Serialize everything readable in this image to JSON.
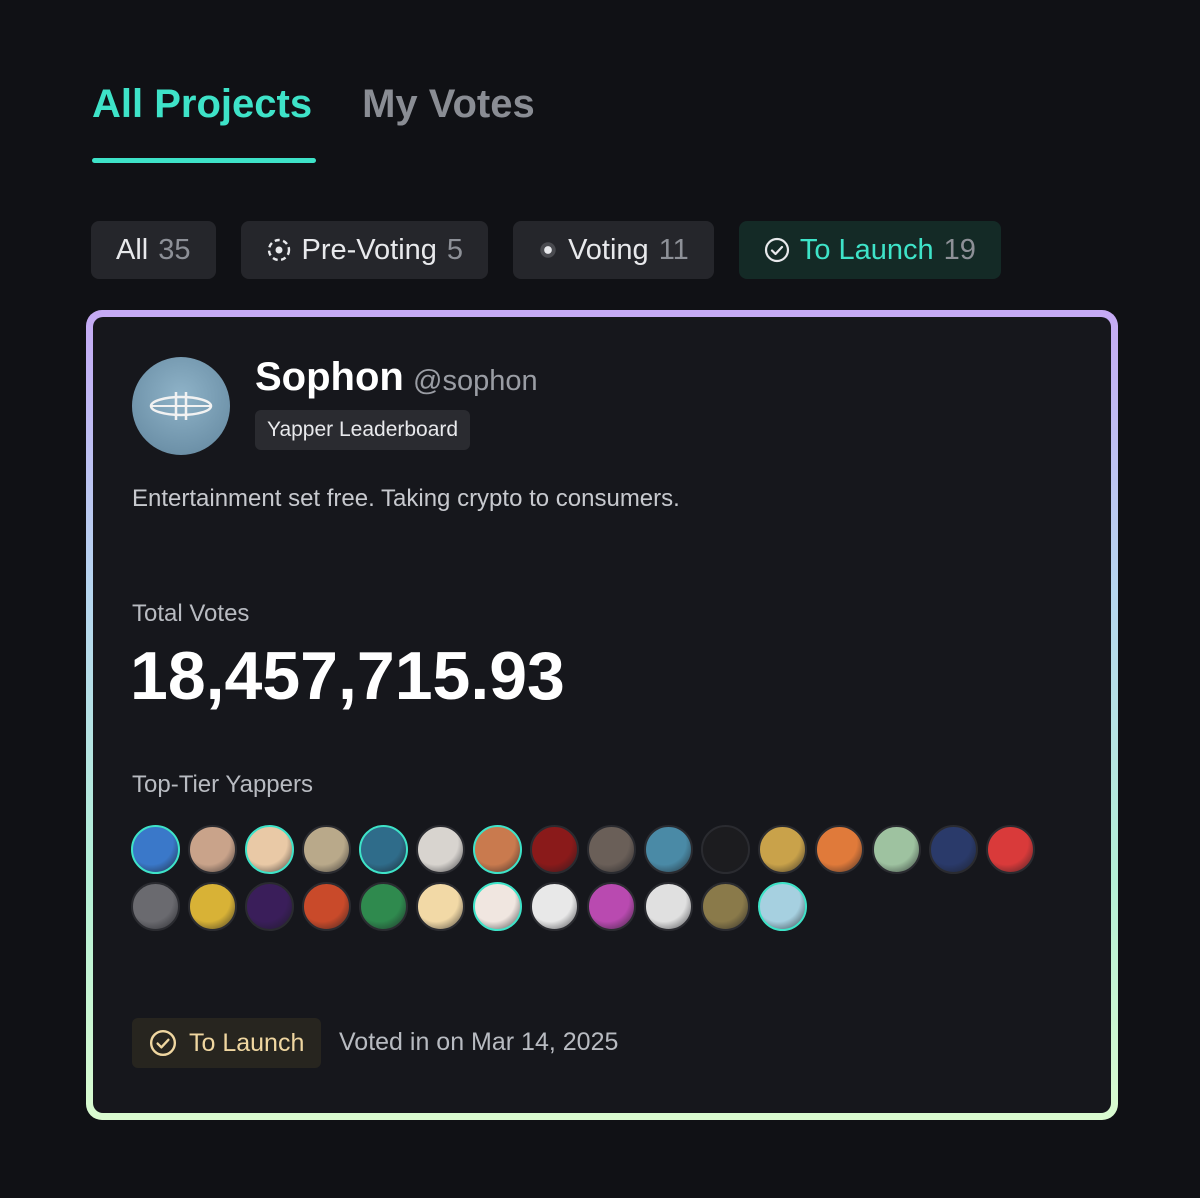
{
  "tabs": [
    {
      "label": "All Projects",
      "active": true
    },
    {
      "label": "My Votes",
      "active": false
    }
  ],
  "filters": [
    {
      "label": "All",
      "count": "35",
      "icon": "none"
    },
    {
      "label": "Pre-Voting",
      "count": "5",
      "icon": "dashed-circle-icon"
    },
    {
      "label": "Voting",
      "count": "11",
      "icon": "dot-icon"
    },
    {
      "label": "To Launch",
      "count": "19",
      "icon": "check-circle-icon",
      "active": true
    }
  ],
  "project": {
    "name": "Sophon",
    "handle": "@sophon",
    "tag": "Yapper Leaderboard",
    "description": "Entertainment set free. Taking crypto to consumers.",
    "total_votes_label": "Total Votes",
    "total_votes": "18,457,715.93",
    "yappers_label": "Top-Tier Yappers",
    "status": "To Launch",
    "voted_text": "Voted in on Mar 14, 2025"
  },
  "colors": {
    "accent": "#3ee3c8",
    "background": "#101115",
    "card": "#16171c",
    "status_badge_text": "#f0d7a1"
  },
  "yappers": [
    {
      "color": "#3a78c9",
      "glyph": "☺",
      "ring": "#3ee3c8"
    },
    {
      "color": "#c9a38a",
      "glyph": "☺",
      "ring": "#2a2b30"
    },
    {
      "color": "#e9c9a6",
      "glyph": "☺",
      "ring": "#3ee3c8"
    },
    {
      "color": "#b9a98a",
      "glyph": "☺",
      "ring": "#2a2b30"
    },
    {
      "color": "#2f6c8a",
      "glyph": "☺",
      "ring": "#3ee3c8"
    },
    {
      "color": "#d8d4cf",
      "glyph": "☺",
      "ring": "#2a2b30"
    },
    {
      "color": "#c97a4e",
      "glyph": "☺",
      "ring": "#3ee3c8"
    },
    {
      "color": "#8a1a1a",
      "glyph": "☺",
      "ring": "#2a2b30"
    },
    {
      "color": "#6a5f58",
      "glyph": "☺",
      "ring": "#2a2b30"
    },
    {
      "color": "#4a8aa6",
      "glyph": "☺",
      "ring": "#2a2b30"
    },
    {
      "color": "#1c1c1f",
      "glyph": "☺",
      "ring": "#2a2b30"
    },
    {
      "color": "#c9a24a",
      "glyph": "☺",
      "ring": "#2a2b30"
    },
    {
      "color": "#e07a3a",
      "glyph": "☺",
      "ring": "#2a2b30"
    },
    {
      "color": "#9ec2a0",
      "glyph": "☺",
      "ring": "#2a2b30"
    },
    {
      "color": "#2a3a6a",
      "glyph": "☺",
      "ring": "#2a2b30"
    },
    {
      "color": "#d93a3a",
      "glyph": "☺",
      "ring": "#2a2b30"
    },
    {
      "color": "#6a6a6f",
      "glyph": "☺",
      "ring": "#2a2b30"
    },
    {
      "color": "#d8b236",
      "glyph": "☺",
      "ring": "#2a2b30"
    },
    {
      "color": "#3a1e5a",
      "glyph": "☺",
      "ring": "#2a2b30"
    },
    {
      "color": "#c94a2a",
      "glyph": "☺",
      "ring": "#2a2b30"
    },
    {
      "color": "#2f8a4e",
      "glyph": "☺",
      "ring": "#2a2b30"
    },
    {
      "color": "#f2d9a6",
      "glyph": "☺",
      "ring": "#2a2b30"
    },
    {
      "color": "#f0e6e0",
      "glyph": "☺",
      "ring": "#3ee3c8"
    },
    {
      "color": "#e8e8e8",
      "glyph": "☺",
      "ring": "#2a2b30"
    },
    {
      "color": "#b94ab0",
      "glyph": "☺",
      "ring": "#2a2b30"
    },
    {
      "color": "#e0e0e0",
      "glyph": "☺",
      "ring": "#2a2b30"
    },
    {
      "color": "#8a7a4a",
      "glyph": "☺",
      "ring": "#2a2b30"
    },
    {
      "color": "#a6d0e0",
      "glyph": "☺",
      "ring": "#3ee3c8"
    }
  ]
}
